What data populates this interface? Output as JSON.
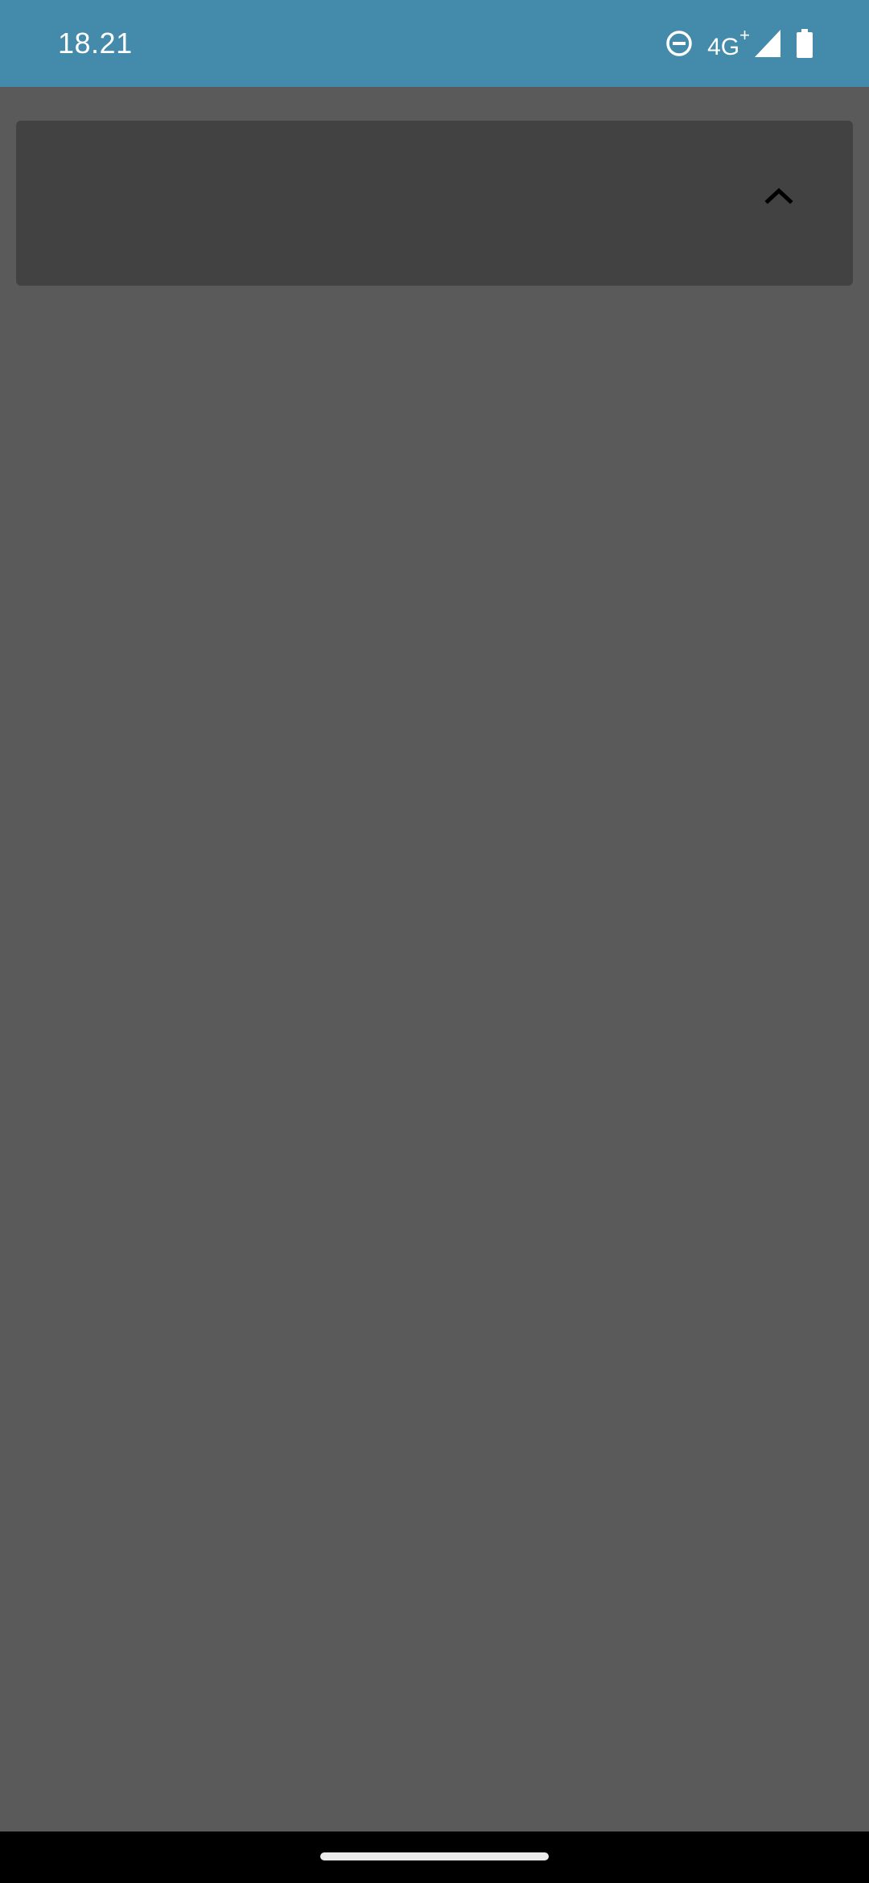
{
  "status_bar": {
    "time": "18.21",
    "network_label": "4G",
    "network_sup": "+",
    "icons": [
      "do-not-disturb-icon",
      "signal-icon",
      "battery-icon"
    ],
    "background_color": "#438aab"
  },
  "panel": {
    "expand_icon": "chevron-up-icon",
    "background_color": "#424242"
  },
  "page": {
    "background_color": "#5a5a5a"
  },
  "nav_bar": {
    "background_color": "#000000"
  }
}
